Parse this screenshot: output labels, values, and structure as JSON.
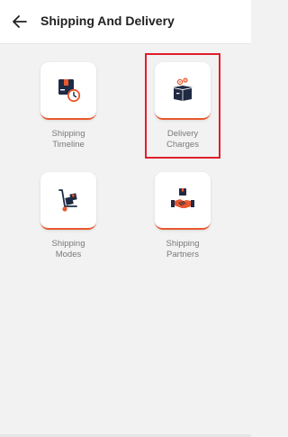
{
  "header": {
    "back_icon": "arrow-left-icon",
    "title": "Shipping And Delivery"
  },
  "tiles": [
    {
      "icon": "shipping-timeline-icon",
      "line1": "Shipping",
      "line2": "Timeline",
      "selected": false
    },
    {
      "icon": "delivery-charges-icon",
      "line1": "Delivery",
      "line2": "Charges",
      "selected": true
    },
    {
      "icon": "shipping-modes-icon",
      "line1": "Shipping",
      "line2": "Modes",
      "selected": false
    },
    {
      "icon": "shipping-partners-icon",
      "line1": "Shipping",
      "line2": "Partners",
      "selected": false
    }
  ],
  "colors": {
    "accent": "#e8582f",
    "navy": "#1f2a44",
    "highlight_border": "#e01e2b",
    "background": "#f2f2f2"
  }
}
